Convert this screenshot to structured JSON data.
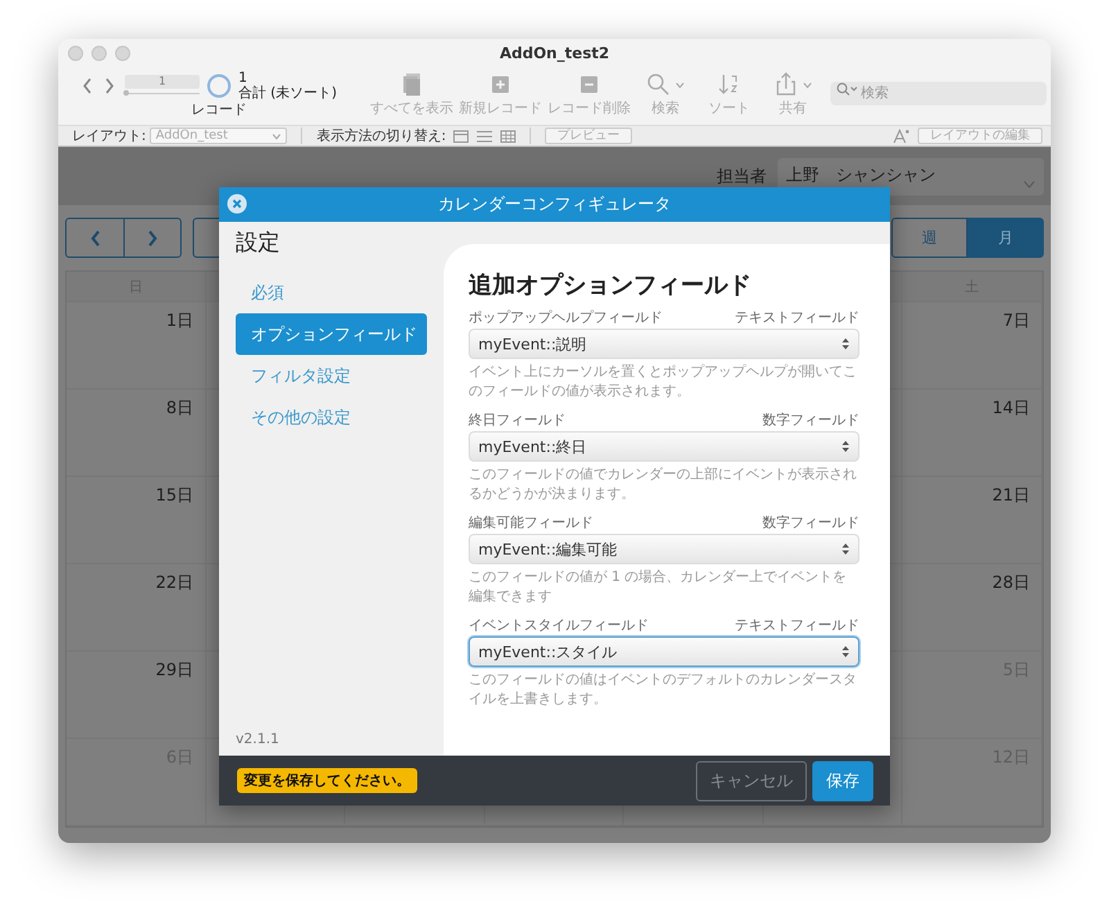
{
  "window": {
    "title": "AddOn_test2"
  },
  "toolbar": {
    "slider": {
      "level": 0
    },
    "record": "1",
    "found": "1",
    "sort_status": "合計 (未ソート)",
    "record_label": "レコード",
    "buttons": [
      {
        "label": "すべてを表示"
      },
      {
        "label": "新規レコード"
      },
      {
        "label": "レコード削除"
      },
      {
        "label": "検索"
      },
      {
        "label": "ソート"
      },
      {
        "label": "共有"
      }
    ],
    "search": {
      "placeholder": "検索"
    }
  },
  "layout_bar": {
    "layout_label": "レイアウト:",
    "layout": "AddOn_test",
    "view_label": "表示方法の切り替え:",
    "preview": "プレビュー",
    "edit_layout": "レイアウトの編集"
  },
  "calendar": {
    "person_label": "担当者",
    "person": "上野　シャンシャン",
    "views": [
      {
        "label": "週",
        "selected": false
      },
      {
        "label": "月",
        "selected": true
      }
    ],
    "sunday_header": "日",
    "saturday_header": "土",
    "weeks": [
      {
        "sunday": {
          "day": "1日",
          "muted": false
        },
        "saturday": {
          "day": "7日",
          "muted": false
        }
      },
      {
        "sunday": {
          "day": "8日",
          "muted": false
        },
        "saturday": {
          "day": "14日",
          "muted": false
        }
      },
      {
        "sunday": {
          "day": "15日",
          "muted": false
        },
        "saturday": {
          "day": "21日",
          "muted": false
        }
      },
      {
        "sunday": {
          "day": "22日",
          "muted": false
        },
        "saturday": {
          "day": "28日",
          "muted": false
        }
      },
      {
        "sunday": {
          "day": "29日",
          "muted": false
        },
        "saturday": {
          "day": "5日",
          "muted": true
        }
      },
      {
        "sunday": {
          "day": "6日",
          "muted": true
        },
        "saturday": {
          "day": "12日",
          "muted": true
        }
      }
    ]
  },
  "dialog": {
    "title": "カレンダーコンフィギュレータ",
    "sidebar_title": "設定",
    "nav": [
      {
        "label": "必須",
        "selected": false
      },
      {
        "label": "オプションフィールド",
        "selected": true
      },
      {
        "label": "フィルタ設定",
        "selected": false
      },
      {
        "label": "その他の設定",
        "selected": false
      }
    ],
    "version": "v2.1.1",
    "section_title": "追加オプションフィールド",
    "fields": [
      {
        "label": "ポップアップヘルプフィールド",
        "type": "テキストフィールド",
        "value": "myEvent::説明",
        "help": "イベント上にカーソルを置くとポップアップヘルプが開いてこのフィールドの値が表示されます。",
        "focused": false
      },
      {
        "label": "終日フィールド",
        "type": "数字フィールド",
        "value": "myEvent::終日",
        "help": "このフィールドの値でカレンダーの上部にイベントが表示されるかどうかが決まります。",
        "focused": false
      },
      {
        "label": "編集可能フィールド",
        "type": "数字フィールド",
        "value": "myEvent::編集可能",
        "help": "このフィールドの値が 1 の場合、カレンダー上でイベントを編集できます",
        "focused": false
      },
      {
        "label": "イベントスタイルフィールド",
        "type": "テキストフィールド",
        "value": "myEvent::スタイル",
        "help": "このフィールドの値はイベントのデフォルトのカレンダースタイルを上書きします。",
        "focused": true
      }
    ],
    "notice": "変更を保存してください。",
    "buttons": [
      {
        "label": "キャンセル",
        "kind": "secondary"
      },
      {
        "label": "保存",
        "kind": "primary"
      }
    ]
  }
}
